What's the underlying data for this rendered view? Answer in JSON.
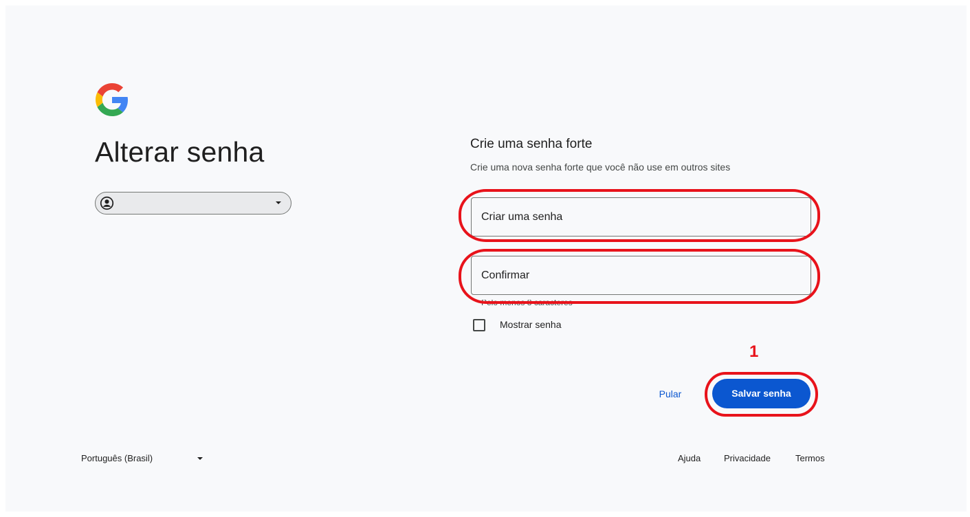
{
  "header": {
    "logo_icon": "google-g-logo",
    "title": "Alterar senha"
  },
  "account": {
    "avatar_icon": "account-circle-icon",
    "email": ""
  },
  "form": {
    "heading": "Crie uma senha forte",
    "subheading": "Crie uma nova senha forte que você não use em outros sites",
    "password_placeholder": "Criar uma senha",
    "confirm_placeholder": "Confirmar",
    "hint": "Pelo menos 8 caracteres",
    "show_password_label": "Mostrar senha",
    "show_password_checked": false
  },
  "actions": {
    "skip_label": "Pular",
    "save_label": "Salvar senha"
  },
  "annotation": {
    "number": "1",
    "color": "#e8131b"
  },
  "footer": {
    "language": "Português (Brasil)",
    "links": [
      "Ajuda",
      "Privacidade",
      "Termos"
    ]
  },
  "colors": {
    "primary": "#0b57d0",
    "background": "#f8f9fb"
  }
}
